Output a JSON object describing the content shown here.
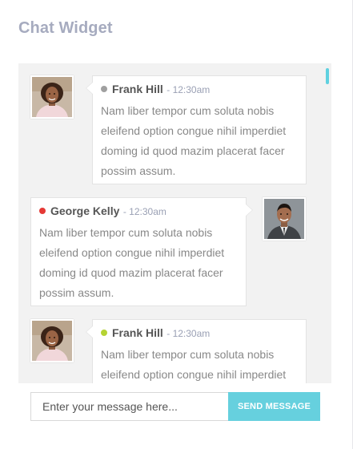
{
  "widget": {
    "title": "Chat Widget"
  },
  "messages": [
    {
      "sender": "Frank Hill",
      "time": "- 12:30am",
      "status_color": "#a0a0a0",
      "avatar": "woman-avatar",
      "text": "Nam liber tempor cum soluta nobis eleifend option congue nihil imperdiet doming id quod mazim placerat facer possim assum."
    },
    {
      "sender": "George Kelly",
      "time": "- 12:30am",
      "status_color": "#e53935",
      "avatar": "man-avatar",
      "text": "Nam liber tempor cum soluta nobis eleifend option congue nihil imperdiet doming id quod mazim placerat facer possim assum."
    },
    {
      "sender": "Frank Hill",
      "time": "- 12:30am",
      "status_color": "#b5d334",
      "avatar": "woman-avatar",
      "text": "Nam liber tempor cum soluta nobis eleifend option congue nihil imperdiet doming id quod mazim placerat facer possim assum."
    }
  ],
  "composer": {
    "placeholder": "Enter your message here...",
    "send_label": "SEND MESSAGE"
  },
  "colors": {
    "accent": "#66d0de",
    "title": "#a6abbf",
    "panel_bg": "#f2f2f2"
  }
}
